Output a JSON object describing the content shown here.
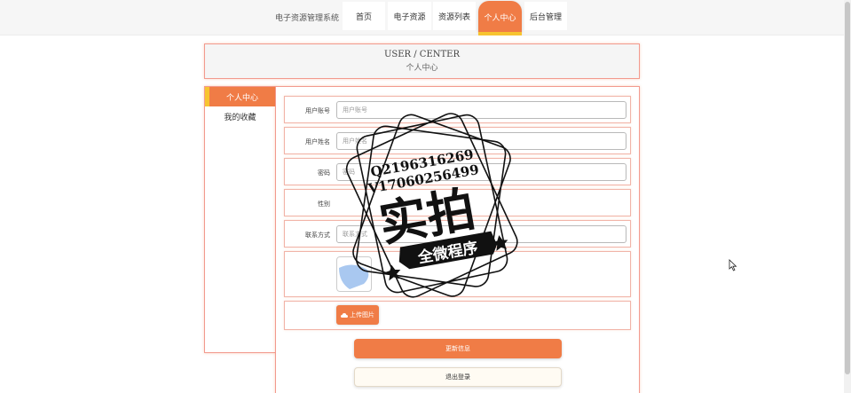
{
  "nav": {
    "brand": "电子资源管理系统",
    "items": [
      {
        "label": "首页"
      },
      {
        "label": "电子资源"
      },
      {
        "label": "资源列表"
      },
      {
        "label": "个人中心"
      },
      {
        "label": "后台管理"
      }
    ],
    "active_index": 3
  },
  "header": {
    "title_en": "USER / CENTER",
    "title_cn": "个人中心"
  },
  "side_menu": {
    "items": [
      {
        "label": "个人中心"
      },
      {
        "label": "我的收藏"
      }
    ]
  },
  "form": {
    "account": {
      "label": "用户账号",
      "placeholder": "用户账号"
    },
    "name": {
      "label": "用户姓名",
      "placeholder": "用户姓名"
    },
    "password": {
      "label": "密码",
      "placeholder": "密码"
    },
    "gender": {
      "label": "性别"
    },
    "contact": {
      "label": "联系方式",
      "placeholder": "联系方式"
    },
    "upload_label": "上传图片"
  },
  "buttons": {
    "update": "更新信息",
    "logout": "退出登录"
  },
  "watermark": {
    "line1": "Q2196316269",
    "line2": "V17060256499",
    "big": "实拍",
    "banner": "全微程序"
  },
  "colors": {
    "accent": "#f07c46",
    "accent_secondary": "#f7c430",
    "border": "#f29a8e"
  }
}
